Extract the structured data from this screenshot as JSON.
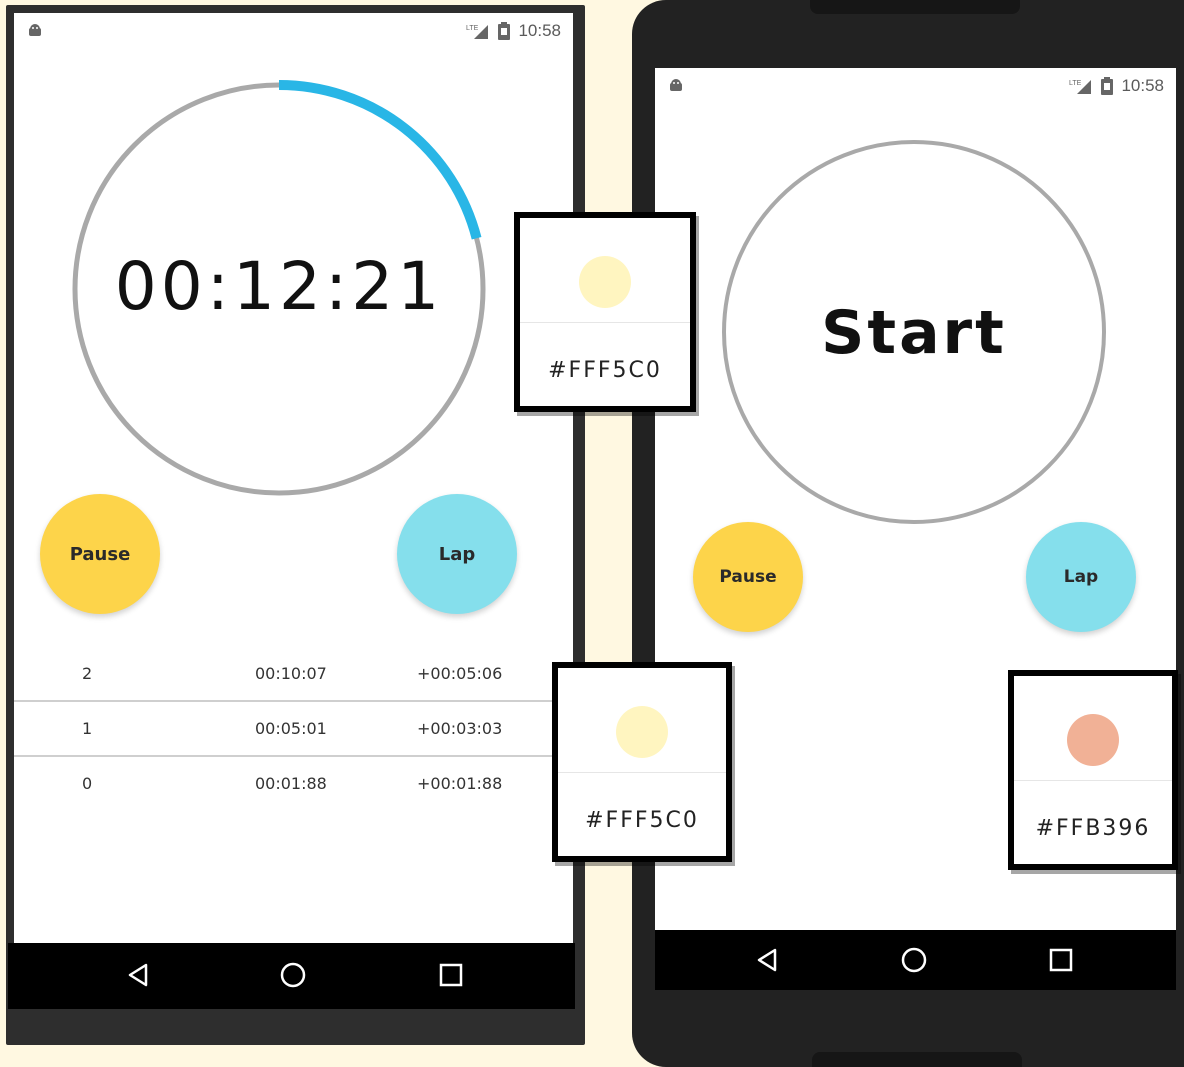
{
  "colors": {
    "page_background": "#FFF8E1",
    "pause_button": "#FDD44A",
    "lap_button": "#85DFEC",
    "progress_arc": "#29B6E6",
    "ring": "#A9A9A9"
  },
  "left_phone": {
    "status_bar": {
      "time": "10:58",
      "icons": [
        "android-icon",
        "lte-signal-icon",
        "battery-icon"
      ]
    },
    "timer": {
      "display": "00:12:21",
      "progress_fraction": 0.21
    },
    "buttons": {
      "pause_label": "Pause",
      "lap_label": "Lap"
    },
    "laps": [
      {
        "number": "2",
        "time": "00:10:07",
        "split": "+00:05:06"
      },
      {
        "number": "1",
        "time": "00:05:01",
        "split": "+00:03:03"
      },
      {
        "number": "0",
        "time": "00:01:88",
        "split": "+00:01:88"
      }
    ],
    "nav_bar": [
      "back-icon",
      "home-icon",
      "recents-icon"
    ]
  },
  "right_phone": {
    "status_bar": {
      "time": "10:58",
      "icons": [
        "android-icon",
        "lte-signal-icon",
        "battery-icon"
      ]
    },
    "start_label": "Start",
    "buttons": {
      "pause_label": "Pause",
      "lap_label": "Lap"
    },
    "nav_bar": [
      "back-icon",
      "home-icon",
      "recents-icon"
    ]
  },
  "swatches": [
    {
      "hex": "#FFF5C0",
      "color": "#FFF5C0"
    },
    {
      "hex": "#FFF5C0",
      "color": "#FFF5C0"
    },
    {
      "hex": "#FFB396",
      "color": "#F1B196"
    }
  ]
}
